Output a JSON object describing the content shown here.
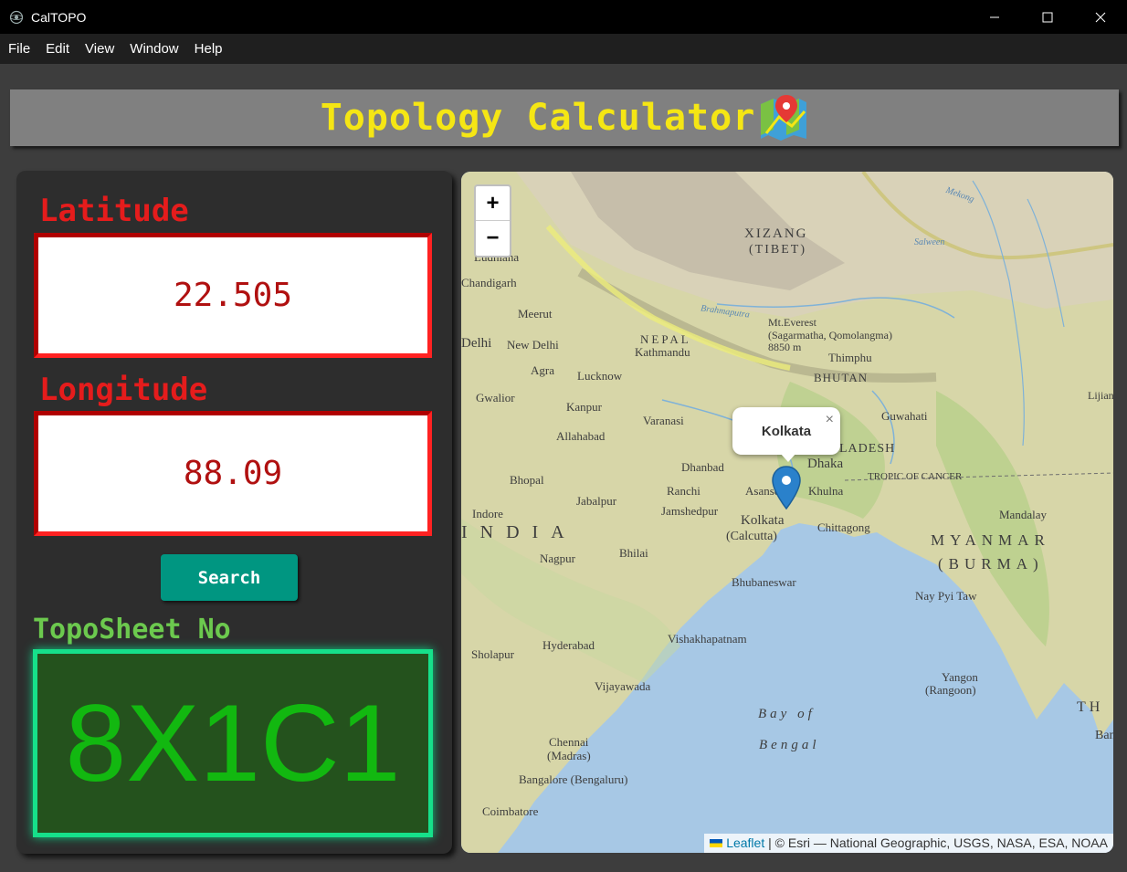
{
  "window": {
    "title": "CalTOPO",
    "controls": {
      "minimize_icon": "minimize-icon",
      "maximize_icon": "maximize-icon",
      "close_icon": "close-icon"
    }
  },
  "menu": [
    "File",
    "Edit",
    "View",
    "Window",
    "Help"
  ],
  "header": {
    "title": "Topology Calculator",
    "icon": "map-pin-icon"
  },
  "form": {
    "latitude_label": "Latitude",
    "latitude_value": "22.505",
    "longitude_label": "Longitude",
    "longitude_value": "88.09",
    "search_label": "Search"
  },
  "result": {
    "label": "TopoSheet No",
    "value": "8X1C1"
  },
  "map": {
    "zoom_in": "+",
    "zoom_out": "−",
    "popup_text": "Kolkata",
    "popup_close": "×",
    "attribution_link": "Leaflet",
    "attribution_text": " | © Esri — National Geographic, USGS, NASA, ESA, NOAA",
    "labels": [
      "XIZANG",
      "(TIBET)",
      "Ludhiana",
      "Chandigarh",
      "Meerut",
      "Delhi",
      "New Delhi",
      "NEPAL",
      "Kathmandu",
      "Mt.Everest",
      "(Sagarmatha, Qomolangma)",
      "8850 m",
      "Thimphu",
      "BHUTAN",
      "Agra",
      "Lucknow",
      "Gwalior",
      "Kanpur",
      "Varanasi",
      "Allahabad",
      "Guwahati",
      "Dhanbad",
      "Dhaka",
      "Ranchi",
      "Asansol",
      "Khulna",
      "Jamshedpur",
      "Kolkata",
      "(Calcutta)",
      "Chittagong",
      "Bhopal",
      "Jabalpur",
      "Indore",
      "INDIA",
      "Nagpur",
      "Bhilai",
      "Bhubaneswar",
      "Mandalay",
      "MYANMAR",
      "(BURMA)",
      "Nay Pyi Taw",
      "Hyderabad",
      "Vishakhapatnam",
      "Sholapur",
      "Vijayawada",
      "Bay of",
      "Bengal",
      "Yangon",
      "(Rangoon)",
      "Chennai",
      "(Madras)",
      "Bangalore (Bengaluru)",
      "Coimbatore",
      "TROPIC OF CANCER",
      "Brahmaputra",
      "Mekong",
      "Salween",
      "Lijiang",
      "LADESH",
      "TH",
      "Ban"
    ]
  }
}
